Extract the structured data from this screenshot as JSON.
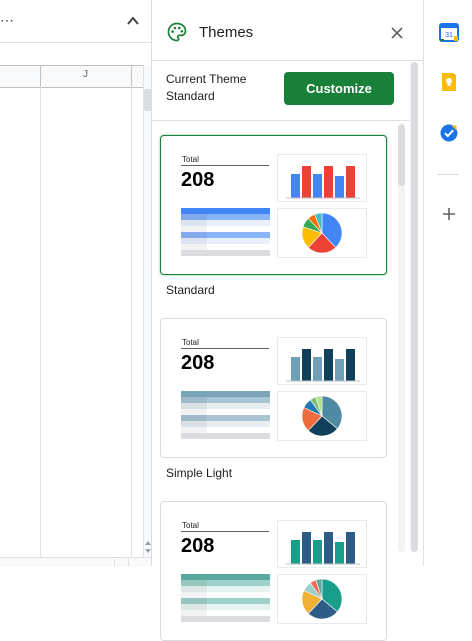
{
  "sheet": {
    "more_glyph": "⋯",
    "column_label": "J"
  },
  "panel": {
    "title": "Themes",
    "current_theme_label": "Current Theme",
    "current_theme_name": "Standard",
    "customize_label": "Customize",
    "themes": [
      {
        "name": "Standard",
        "selected": true,
        "total_label": "Total",
        "total_value": "208",
        "bar_colors": [
          "#4285f4",
          "#ea4335",
          "#4285f4",
          "#ea4335",
          "#4285f4",
          "#ea4335"
        ],
        "bar_values": [
          0.75,
          1.0,
          0.75,
          1.0,
          0.7,
          1.0
        ],
        "table_colors": {
          "header": "#4285f4",
          "band": "#8ab4f8",
          "light": "#e8f0fe"
        },
        "pie_colors": [
          "#4285f4",
          "#ea4335",
          "#fbbc04",
          "#34a853",
          "#ff6d01",
          "#46bdc6"
        ],
        "pie_shares": [
          0.38,
          0.24,
          0.18,
          0.08,
          0.06,
          0.06
        ]
      },
      {
        "name": "Simple Light",
        "selected": false,
        "total_label": "Total",
        "total_value": "208",
        "bar_colors": [
          "#6fa0b8",
          "#10405a",
          "#6fa0b8",
          "#10405a",
          "#6fa0b8",
          "#10405a"
        ],
        "bar_values": [
          0.75,
          1.0,
          0.75,
          1.0,
          0.7,
          1.0
        ],
        "table_colors": {
          "header": "#7ba3b9",
          "band": "#a9c4d2",
          "light": "#e6eef2"
        },
        "pie_colors": [
          "#4f8aa3",
          "#10405a",
          "#ef6c3d",
          "#1f78b4",
          "#7fbf7b",
          "#b2df8a"
        ],
        "pie_shares": [
          0.36,
          0.26,
          0.2,
          0.08,
          0.05,
          0.05
        ]
      },
      {
        "name": "",
        "selected": false,
        "total_label": "Total",
        "total_value": "208",
        "bar_colors": [
          "#1a9e8c",
          "#2d5d86",
          "#1a9e8c",
          "#2d5d86",
          "#1a9e8c",
          "#2d5d86"
        ],
        "bar_values": [
          0.75,
          1.0,
          0.75,
          1.0,
          0.7,
          1.0
        ],
        "table_colors": {
          "header": "#5aa9a0",
          "band": "#9fd0c9",
          "light": "#e6f4f1"
        },
        "pie_colors": [
          "#1a9e8c",
          "#2d5d86",
          "#f2b134",
          "#9fd0c9",
          "#ed6a5a",
          "#5aa9a0"
        ],
        "pie_shares": [
          0.36,
          0.26,
          0.2,
          0.08,
          0.05,
          0.05
        ]
      }
    ]
  },
  "rail": {
    "calendar_badge": "31",
    "icons": [
      "calendar-icon",
      "keep-icon",
      "tasks-icon",
      "add-icon"
    ]
  },
  "colors": {
    "accent_green": "#188038",
    "card_border": "#dadce0"
  }
}
